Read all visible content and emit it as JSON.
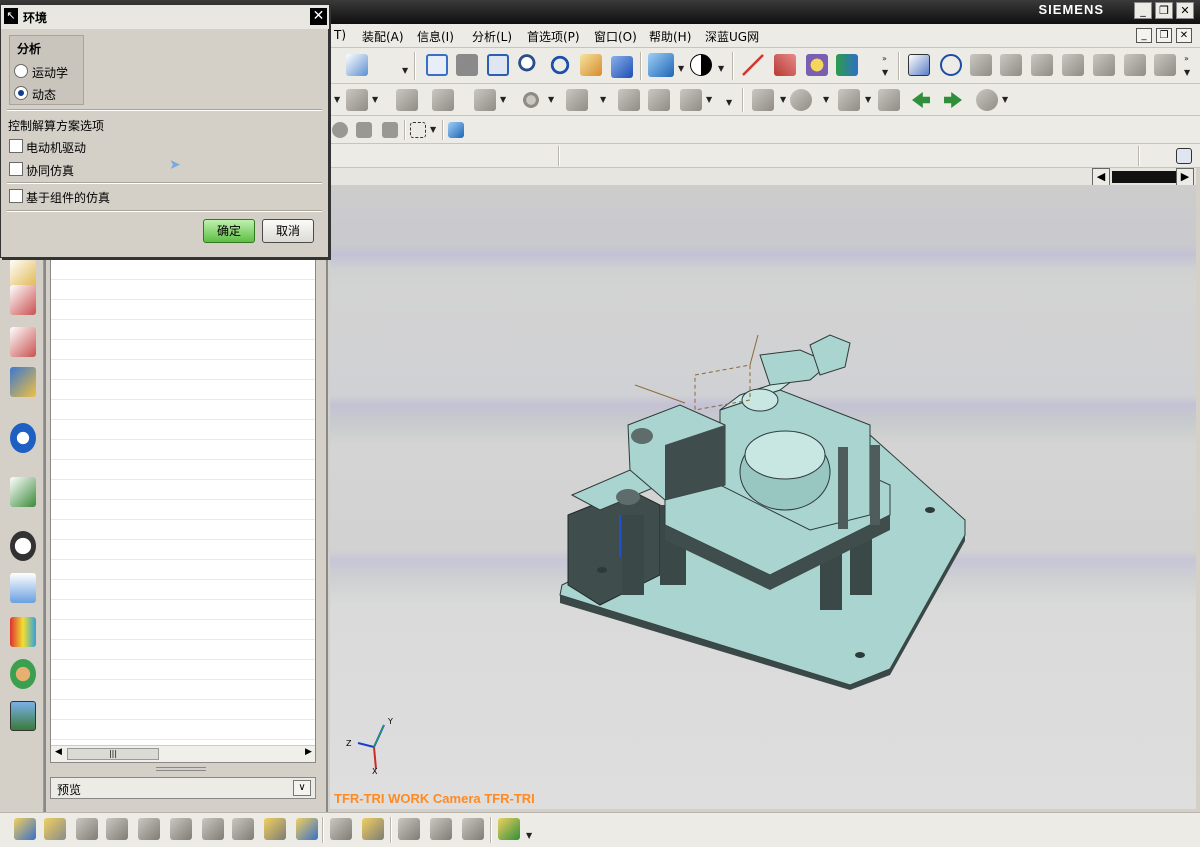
{
  "app": {
    "brand": "SIEMENS"
  },
  "window_buttons": {
    "minimize": "_",
    "restore": "❐",
    "close": "✕"
  },
  "menubar": {
    "items": [
      {
        "label": "T)"
      },
      {
        "label": "装配(A)"
      },
      {
        "label": "信息(I)"
      },
      {
        "label": "分析(L)"
      },
      {
        "label": "首选项(P)"
      },
      {
        "label": "窗口(O)"
      },
      {
        "label": "帮助(H)"
      },
      {
        "label": "深蓝UG网"
      }
    ],
    "mdi_buttons": {
      "minimize": "_",
      "restore": "❐",
      "close": "✕"
    }
  },
  "dialog": {
    "title": "环境",
    "close": "✕",
    "analysis_group": {
      "title": "分析",
      "options": [
        {
          "label": "运动学",
          "selected": false
        },
        {
          "label": "动态",
          "selected": true
        }
      ]
    },
    "solver_options_title": "控制解算方案选项",
    "checkboxes": [
      {
        "label": "电动机驱动",
        "checked": false
      },
      {
        "label": "协同仿真",
        "checked": false
      },
      {
        "label": "基于组件的仿真",
        "checked": false
      }
    ],
    "ok_label": "确定",
    "cancel_label": "取消"
  },
  "navigator": {
    "preview_label": "预览",
    "scroll_grip": "|||"
  },
  "viewport": {
    "camera_label": "TFR-TRI WORK Camera TFR-TRI",
    "triad": {
      "x": "X",
      "y": "Y",
      "z": "Z"
    }
  },
  "icons": {
    "left_bar": [
      "assembly-navigator-icon",
      "constraint-navigator-icon",
      "part-navigator-icon",
      "reuse-library-icon",
      "info-icon",
      "web-browser-icon",
      "history-icon",
      "system-materials-icon",
      "palette-icon",
      "roles-icon",
      "system-scenes-icon"
    ]
  },
  "colors": {
    "accent_ok": "#5fbf44",
    "camera_label": "#ff8a22",
    "model_face": "#a7d4cf",
    "model_dark": "#3b4a49"
  }
}
